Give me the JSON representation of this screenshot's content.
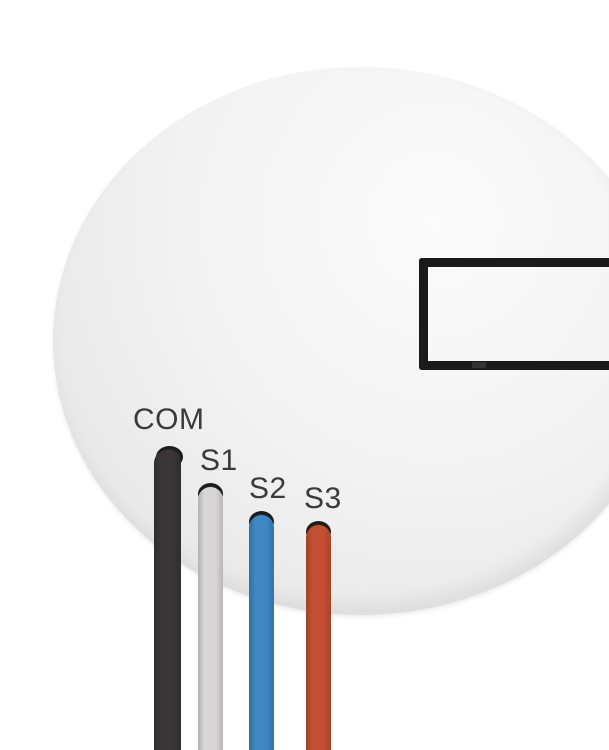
{
  "labels": {
    "com": "COM",
    "s1": "S1",
    "s2": "S2",
    "s3": "S3"
  },
  "wires": [
    {
      "name": "com",
      "color": "#3b3536"
    },
    {
      "name": "s1",
      "color": "#d9d6d6"
    },
    {
      "name": "s2",
      "color": "#3e86c4"
    },
    {
      "name": "s3",
      "color": "#c44f33"
    }
  ],
  "colors": {
    "device_body": "#f1f1f1",
    "slot_outline": "#1a1a1a",
    "label_text": "#3a3a3a"
  }
}
